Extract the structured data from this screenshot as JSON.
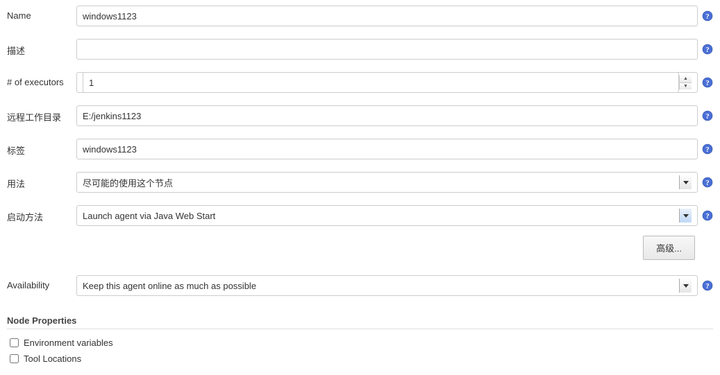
{
  "form": {
    "name": {
      "label": "Name",
      "value": "windows1123"
    },
    "description": {
      "label": "描述",
      "value": ""
    },
    "executors": {
      "label": "# of executors",
      "value": "1"
    },
    "remoteDir": {
      "label": "远程工作目录",
      "value": "E:/jenkins1123"
    },
    "labels": {
      "label": "标签",
      "value": "windows1123"
    },
    "usage": {
      "label": "用法",
      "selected": "尽可能的使用这个节点"
    },
    "launchMethod": {
      "label": "启动方法",
      "selected": "Launch agent via Java Web Start"
    },
    "advancedButton": "高级...",
    "availability": {
      "label": "Availability",
      "selected": "Keep this agent online as much as possible"
    }
  },
  "nodeProperties": {
    "header": "Node Properties",
    "envVars": "Environment variables",
    "toolLocations": "Tool Locations"
  }
}
